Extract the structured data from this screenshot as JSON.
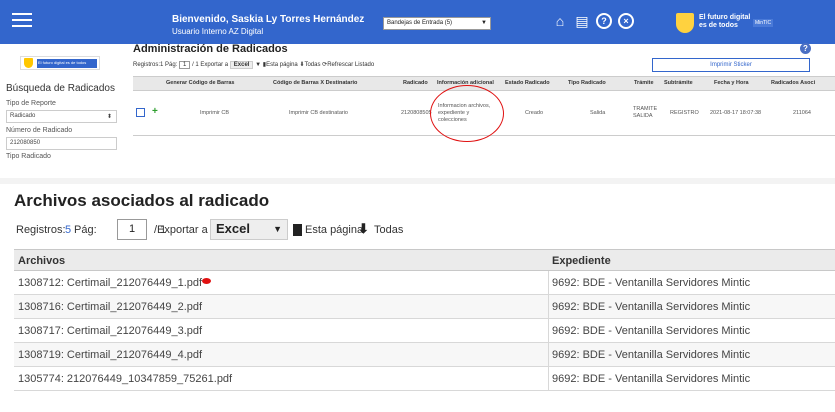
{
  "header": {
    "welcome": "Bienvenido, Saskia Ly Torres Hernández",
    "user_type": "Usuario Interno AZ Digital",
    "inbox_select": "Bandejas de Entrada (5)",
    "brand_text": "El futuro digital es de todos",
    "brand_ministry": "MinTIC",
    "icons": [
      "home-icon",
      "document-icon",
      "help-icon",
      "close-icon"
    ]
  },
  "sidebar": {
    "logo_text": "El futuro digital es de todos",
    "logo_ministry": "MinTIC",
    "title": "Búsqueda de Radicados",
    "report_type_label": "Tipo de Reporte",
    "report_type_value": "Radicado",
    "number_label": "Número de Radicado",
    "number_value": "212080850",
    "type_label": "Tipo Radicado"
  },
  "admin": {
    "title": "Administración de Radicados",
    "records": "Registros:1",
    "page_label": "Pág:",
    "page_value": "1",
    "page_total": "/ 1",
    "export_label": "Exportar a",
    "export_value": "Excel",
    "this_page": "Esta página",
    "all": "Todas",
    "refresh": "Refrescar Listado",
    "sticker_button": "Imprimir Sticker",
    "columns": [
      "Generar Código de Barras",
      "Código de Barras X Destinatario",
      "Radicado",
      "Información adicional",
      "Estado Radicado",
      "Tipo Radicado",
      "Trámite",
      "Subtrámite",
      "Fecha y Hora",
      "Radicados Asoci"
    ],
    "row": {
      "barcode": "Imprimir CB",
      "barcode_dest": "Imprimir CB destinatario",
      "radicado": "2120808505",
      "info_line1": "Informacion archivos,",
      "info_line2": "expediente y",
      "info_line3": "colecciones",
      "estado": "Creado",
      "tipo": "Salida",
      "tramite_line1": "TRAMITE",
      "tramite_line2": "SALIDA",
      "subtramite": "REGISTRO",
      "fecha": "2021-08-17 18:07:38",
      "asociados": "211064"
    }
  },
  "files_panel": {
    "title": "Archivos asociados al radicado",
    "records_label": "Registros:",
    "records_value": "5",
    "page_label": "Pág:",
    "page_value": "1",
    "page_total": "/ 1",
    "export_label": "Exportar a",
    "export_value": "Excel",
    "this_page": "Esta página",
    "all": "Todas",
    "col_files": "Archivos",
    "col_expediente": "Expediente",
    "rows": [
      {
        "file": "1308712: Certimail_212076449_1.pdf",
        "expediente": "9692: BDE - Ventanilla Servidores Mintic"
      },
      {
        "file": "1308716: Certimail_212076449_2.pdf",
        "expediente": "9692: BDE - Ventanilla Servidores Mintic"
      },
      {
        "file": "1308717: Certimail_212076449_3.pdf",
        "expediente": "9692: BDE - Ventanilla Servidores Mintic"
      },
      {
        "file": "1308719: Certimail_212076449_4.pdf",
        "expediente": "9692: BDE - Ventanilla Servidores Mintic"
      },
      {
        "file": "1305774: 212076449_10347859_75261.pdf",
        "expediente": "9692: BDE - Ventanilla Servidores Mintic"
      }
    ]
  },
  "colors": {
    "header_blue": "#3366cc",
    "annotation_red": "#e01010"
  }
}
